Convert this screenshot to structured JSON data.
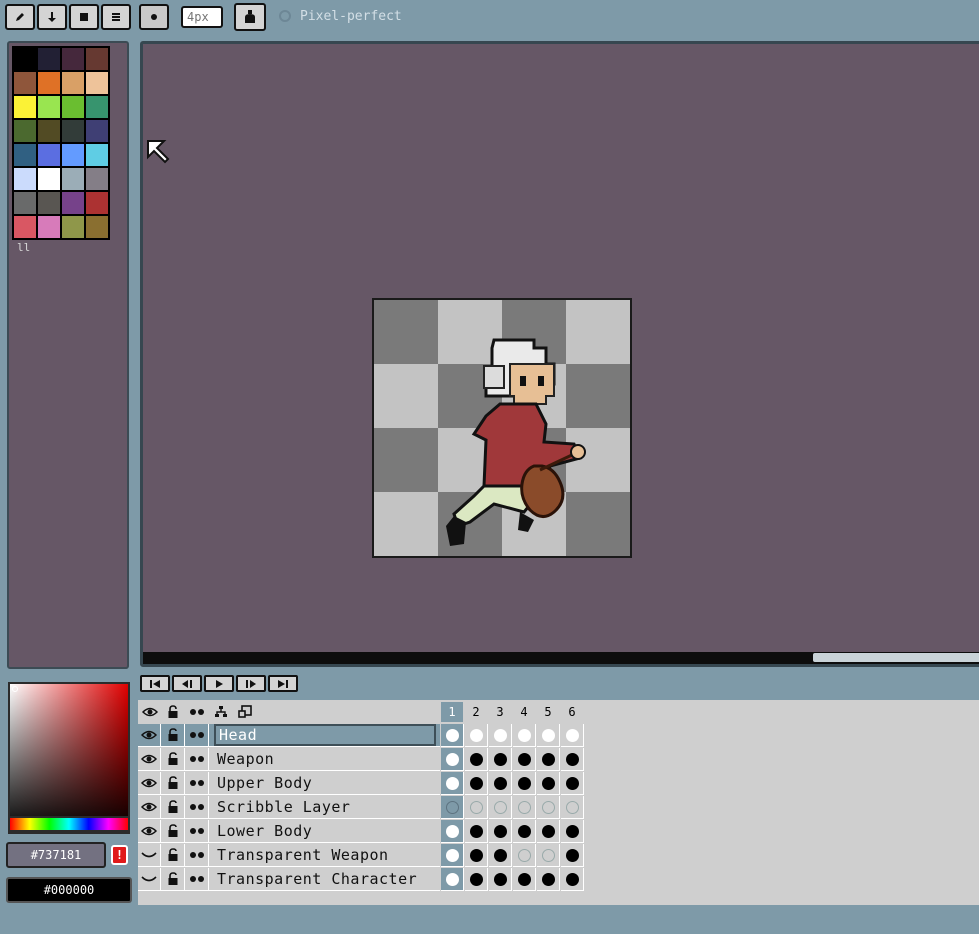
{
  "toolbar": {
    "tools": [
      {
        "name": "pencil-tool",
        "icon": "pencil-icon"
      },
      {
        "name": "fill-down-tool",
        "icon": "arrow-down-icon"
      },
      {
        "name": "rectangle-tool",
        "icon": "square-icon"
      },
      {
        "name": "menu-tool",
        "icon": "menu-icon"
      },
      {
        "name": "brush-size-tool",
        "icon": "dot-icon"
      }
    ],
    "brush_size_placeholder": "4px",
    "ink_icon": "ink-bottle-icon",
    "pixel_perfect_label": "Pixel-perfect"
  },
  "palette": {
    "colors": [
      "#000000",
      "#222034",
      "#45283c",
      "#663931",
      "#8f563b",
      "#df7126",
      "#d9a066",
      "#eec39a",
      "#fbf236",
      "#99e550",
      "#6abe30",
      "#37946e",
      "#4b692f",
      "#524b24",
      "#323c39",
      "#3f3f74",
      "#306082",
      "#5b6ee1",
      "#639bff",
      "#5fcde4",
      "#cbdbfc",
      "#ffffff",
      "#9badb7",
      "#847e87",
      "#696a6a",
      "#595652",
      "#76428a",
      "#ac3232",
      "#d95763",
      "#d77bba",
      "#8f974a",
      "#8a6f30"
    ],
    "more_marker": "ll"
  },
  "color_picker": {
    "primary_hex": "#737181",
    "secondary_hex": "#000000",
    "warning_label": "!"
  },
  "animation_controls": [
    {
      "name": "first-frame-button",
      "icon": "skip-start-icon"
    },
    {
      "name": "previous-frame-button",
      "icon": "step-back-icon"
    },
    {
      "name": "play-button",
      "icon": "play-icon"
    },
    {
      "name": "next-frame-button",
      "icon": "step-forward-icon"
    },
    {
      "name": "last-frame-button",
      "icon": "skip-end-icon"
    }
  ],
  "timeline": {
    "header_icons": [
      "eye-icon",
      "lock-icon",
      "onion-skin-icon",
      "link-icon",
      "layer-square-icon"
    ],
    "frames": [
      "1",
      "2",
      "3",
      "4",
      "5",
      "6"
    ],
    "current_frame": 1,
    "layers": [
      {
        "name": "Head",
        "visible": true,
        "selected": true,
        "cels": [
          "white",
          "white",
          "white",
          "white",
          "white",
          "white"
        ]
      },
      {
        "name": "Weapon",
        "visible": true,
        "selected": false,
        "cels": [
          "white",
          "filled",
          "filled",
          "filled",
          "filled",
          "filled"
        ]
      },
      {
        "name": "Upper Body",
        "visible": true,
        "selected": false,
        "cels": [
          "white",
          "filled",
          "filled",
          "filled",
          "filled",
          "filled"
        ]
      },
      {
        "name": "Scribble Layer",
        "visible": true,
        "selected": false,
        "cels": [
          "empty",
          "empty",
          "empty",
          "empty",
          "empty",
          "empty"
        ]
      },
      {
        "name": "Lower Body",
        "visible": true,
        "selected": false,
        "cels": [
          "white",
          "filled",
          "filled",
          "filled",
          "filled",
          "filled"
        ]
      },
      {
        "name": "Transparent Weapon",
        "visible": false,
        "selected": false,
        "cels": [
          "white",
          "filled",
          "filled",
          "empty",
          "empty",
          "filled"
        ]
      },
      {
        "name": "Transparent Character",
        "visible": false,
        "selected": false,
        "cels": [
          "white",
          "filled",
          "filled",
          "filled",
          "filled",
          "filled"
        ]
      }
    ]
  }
}
